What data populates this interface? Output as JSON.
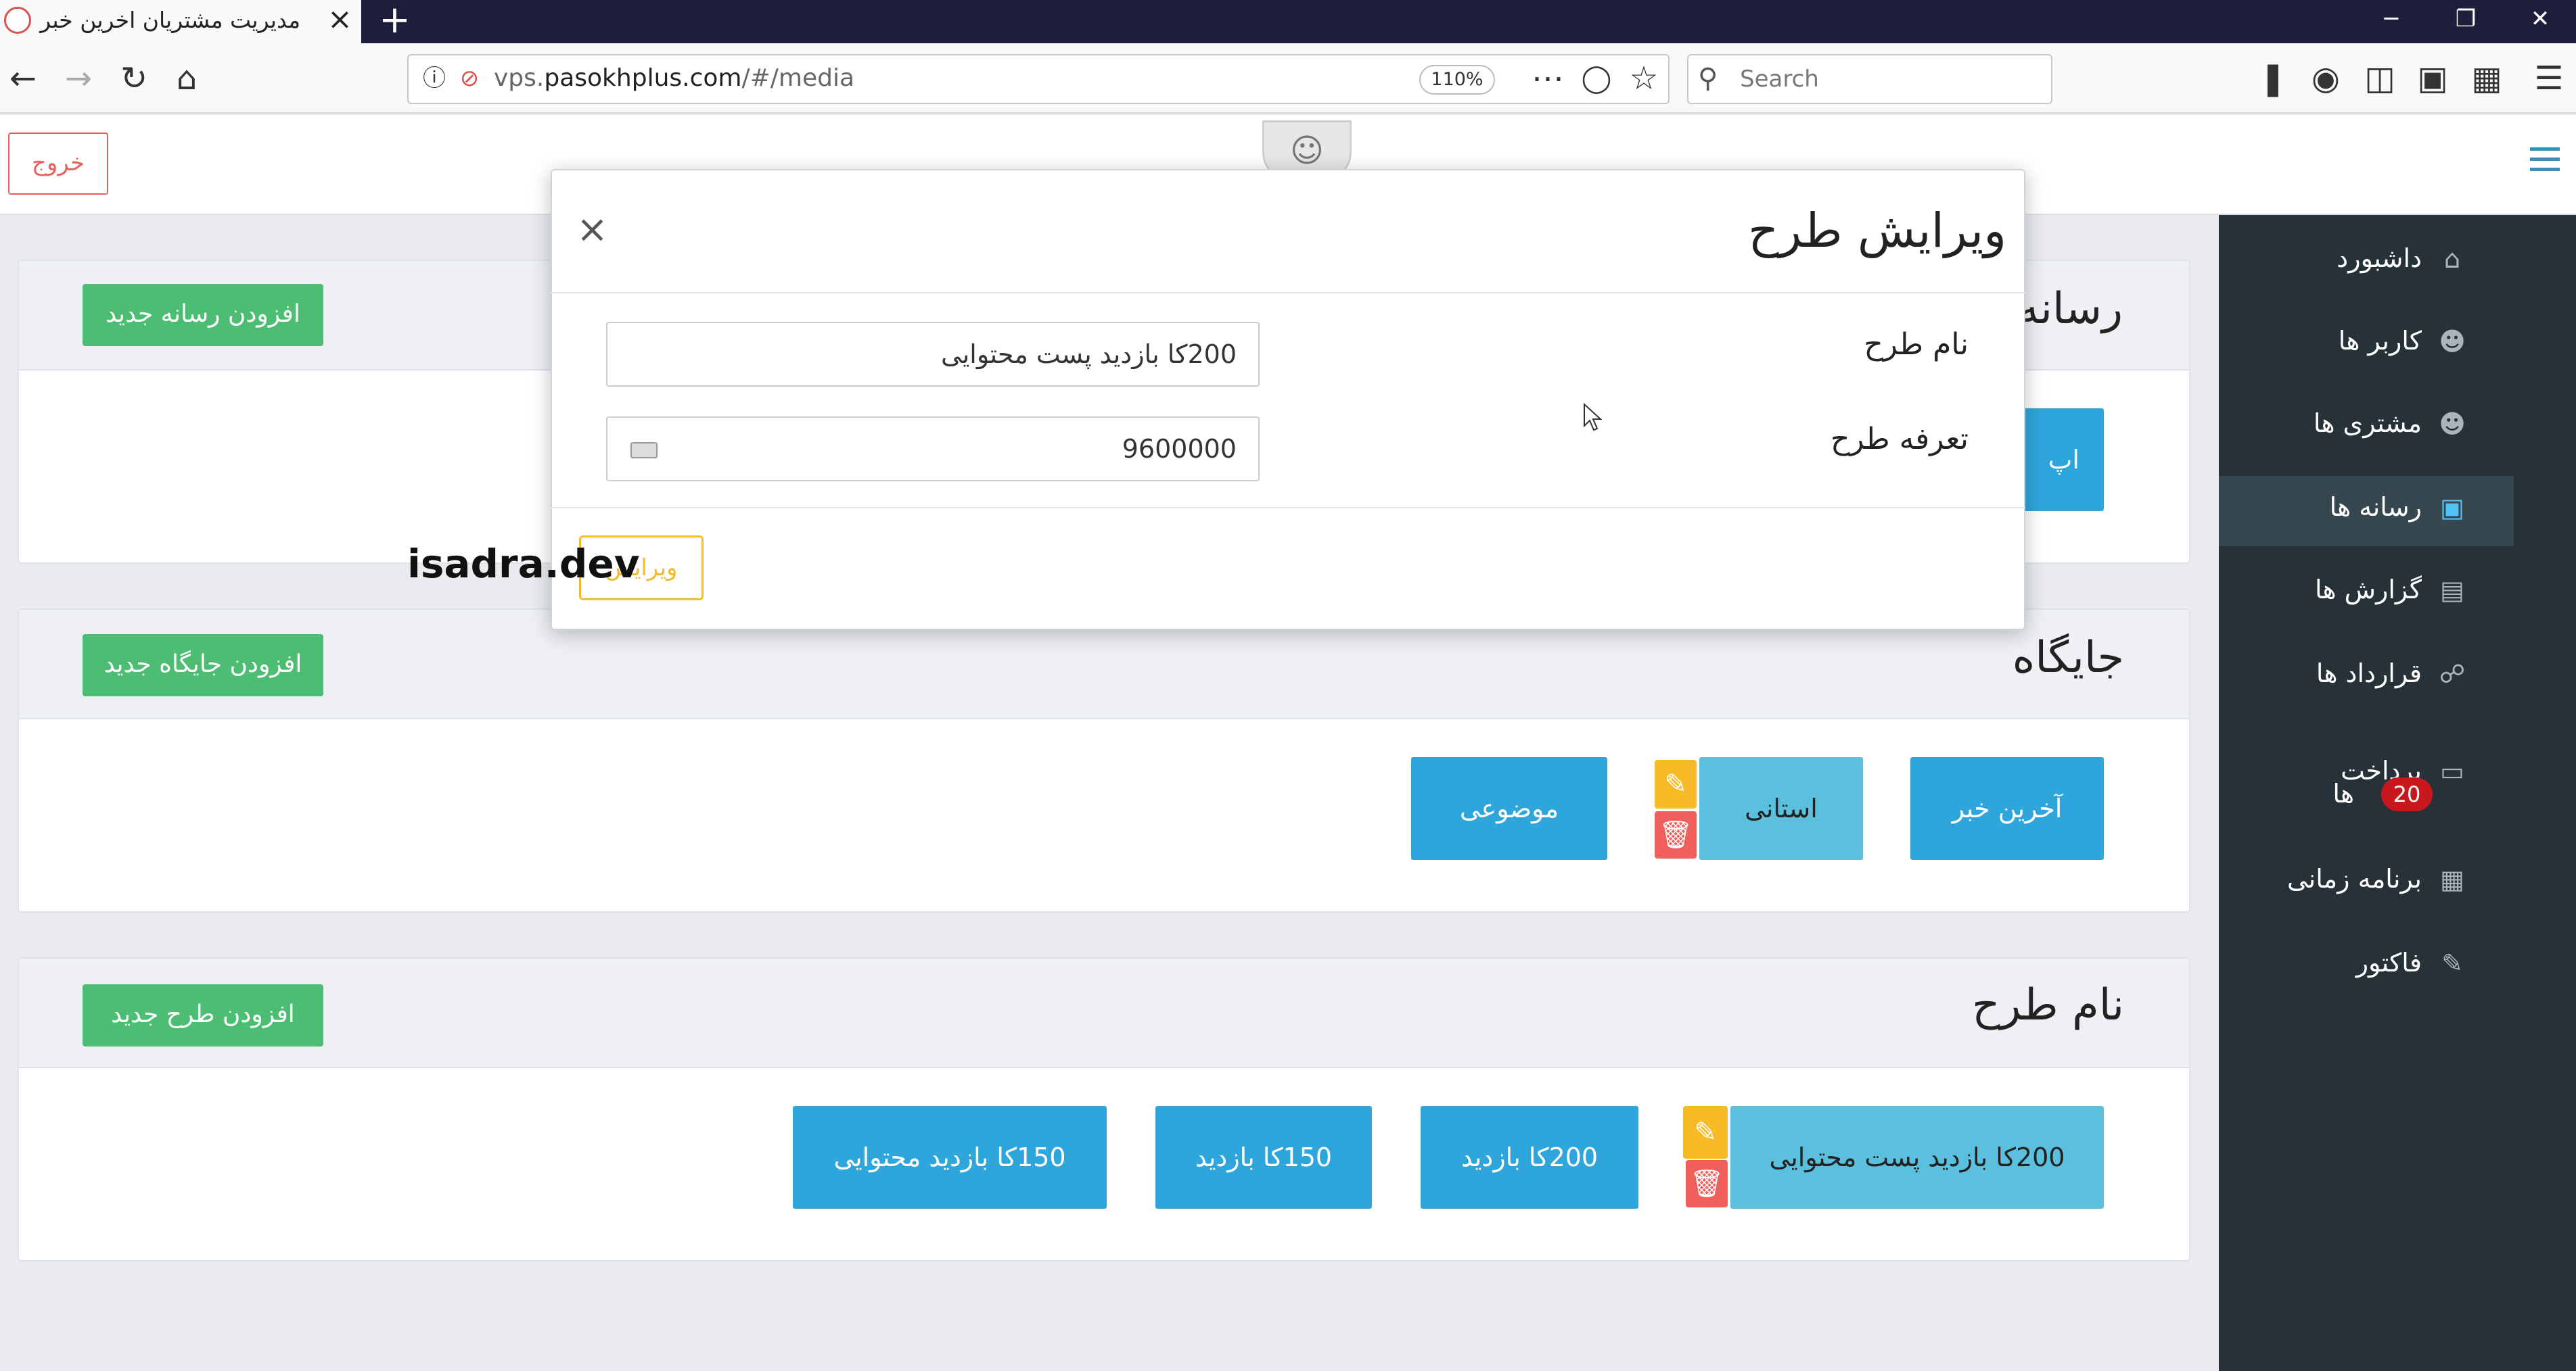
{
  "browser": {
    "tab_title": "مدیریت مشتریان اخرین خبر",
    "tab_close": "×",
    "new_tab": "+",
    "url_host": "vps.pasokhplus.com",
    "url_prefix": "vps.",
    "url_domain": "pasokhplus.com",
    "url_path": "/#/media",
    "zoom": "110%",
    "search_placeholder": "Search",
    "window_min": "─",
    "window_max": "❐",
    "window_close": "✕"
  },
  "header": {
    "logout_label": "خروج"
  },
  "sidebar": {
    "items": [
      {
        "label": "داشبورد",
        "icon": "home-icon"
      },
      {
        "label": "کاربر ها",
        "icon": "user-icon"
      },
      {
        "label": "مشتری ها",
        "icon": "customers-icon"
      },
      {
        "label": "رسانه ها",
        "icon": "instagram-icon"
      },
      {
        "label": "گزارش ها",
        "icon": "book-icon"
      },
      {
        "label": "قرارداد ها",
        "icon": "cart-icon"
      },
      {
        "label": "پرداخت",
        "label2": "ها",
        "icon": "credit-card-icon",
        "badge": "20"
      },
      {
        "label": "برنامه زمانی",
        "icon": "calendar-icon"
      },
      {
        "label": "فاکتور",
        "icon": "edit-icon"
      }
    ]
  },
  "panels": {
    "media": {
      "title": "رسانه",
      "add_label": "افزودن رسانه جدید",
      "item_partial": "اپ"
    },
    "position": {
      "title": "جایگاه",
      "add_label": "افزودن جایگاه جدید",
      "items": [
        "آخرین خبر",
        "استانی",
        "موضوعی"
      ]
    },
    "plan": {
      "title": "نام طرح",
      "add_label": "افزودن طرح جدید",
      "items": [
        "200کا بازدید پست محتوایی",
        "200کا بازدید",
        "150کا بازدید",
        "150کا بازدید محتوایی"
      ]
    }
  },
  "modal": {
    "title": "ویرایش طرح",
    "close": "×",
    "name_label": "نام طرح",
    "name_value": "200کا بازدید پست محتوایی",
    "price_label": "تعرفه طرح",
    "price_value": "9600000",
    "submit_label": "ویرایش"
  },
  "watermark": "isadra.dev",
  "colors": {
    "primary": "#2ea6dc",
    "selected": "#5bc0de",
    "success": "#4dbd74",
    "warning": "#f6bb26",
    "danger": "#ef5f5b",
    "sidebar": "#263238"
  }
}
